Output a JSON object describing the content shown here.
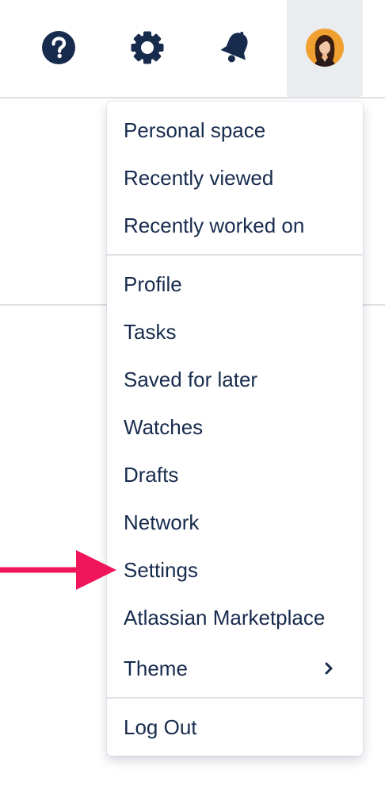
{
  "header": {
    "help_icon": "help-icon",
    "settings_icon": "gear-icon",
    "notifications_icon": "bell-icon",
    "avatar_icon": "user-avatar"
  },
  "menu": {
    "group1": [
      {
        "label": "Personal space"
      },
      {
        "label": "Recently viewed"
      },
      {
        "label": "Recently worked on"
      }
    ],
    "group2": [
      {
        "label": "Profile"
      },
      {
        "label": "Tasks"
      },
      {
        "label": "Saved for later"
      },
      {
        "label": "Watches"
      },
      {
        "label": "Drafts"
      },
      {
        "label": "Network"
      },
      {
        "label": "Settings"
      },
      {
        "label": "Atlassian Marketplace"
      },
      {
        "label": "Theme",
        "has_submenu": true
      }
    ],
    "group3": [
      {
        "label": "Log Out"
      }
    ]
  },
  "annotation": {
    "arrow_color": "#F0145A",
    "points_to": "Settings"
  },
  "colors": {
    "text": "#172B4D",
    "separator": "#DFE1E6",
    "active_bg": "#EBECF0",
    "avatar_bg": "#F0A030"
  }
}
